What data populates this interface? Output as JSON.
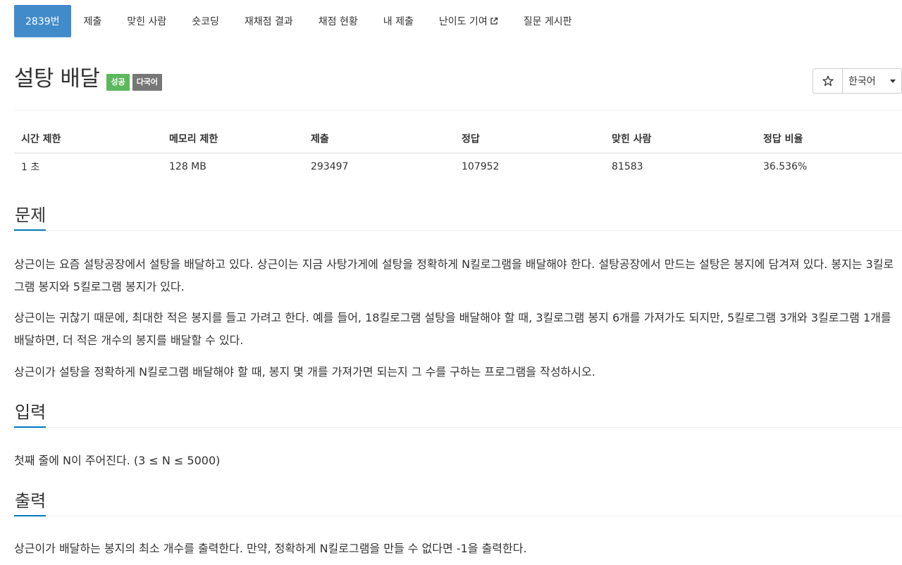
{
  "tabs": [
    {
      "label": "2839번",
      "active": true
    },
    {
      "label": "제출",
      "active": false
    },
    {
      "label": "맞힌 사람",
      "active": false
    },
    {
      "label": "숏코딩",
      "active": false
    },
    {
      "label": "재채점 결과",
      "active": false
    },
    {
      "label": "채점 현황",
      "active": false
    },
    {
      "label": "내 제출",
      "active": false
    },
    {
      "label": "난이도 기여",
      "active": false,
      "icon": "external-link-icon"
    },
    {
      "label": "질문 게시판",
      "active": false
    }
  ],
  "problem": {
    "title": "설탕 배달",
    "badges": [
      {
        "label": "성공",
        "color": "#5cb85c"
      },
      {
        "label": "다국어",
        "color": "#777777"
      }
    ]
  },
  "controls": {
    "favorite_icon": "star-icon",
    "language_label": "한국어"
  },
  "info_table": {
    "headers": [
      "시간 제한",
      "메모리 제한",
      "제출",
      "정답",
      "맞힌 사람",
      "정답 비율"
    ],
    "values": [
      "1 초",
      "128 MB",
      "293497",
      "107952",
      "81583",
      "36.536%"
    ]
  },
  "sections": {
    "description": {
      "heading": "문제",
      "paragraphs": [
        "상근이는 요즘 설탕공장에서 설탕을 배달하고 있다. 상근이는 지금 사탕가게에 설탕을 정확하게 N킬로그램을 배달해야 한다. 설탕공장에서 만드는 설탕은 봉지에 담겨져 있다. 봉지는 3킬로그램 봉지와 5킬로그램 봉지가 있다.",
        "상근이는 귀찮기 때문에, 최대한 적은 봉지를 들고 가려고 한다. 예를 들어, 18킬로그램 설탕을 배달해야 할 때, 3킬로그램 봉지 6개를 가져가도 되지만, 5킬로그램 3개와 3킬로그램 1개를 배달하면, 더 적은 개수의 봉지를 배달할 수 있다.",
        "상근이가 설탕을 정확하게 N킬로그램 배달해야 할 때, 봉지 몇 개를 가져가면 되는지 그 수를 구하는 프로그램을 작성하시오."
      ]
    },
    "input": {
      "heading": "입력",
      "text": "첫째 줄에 N이 주어진다. (3 ≤ N ≤ 5000)"
    },
    "output": {
      "heading": "출력",
      "text": "상근이가 배달하는 봉지의 최소 개수를 출력한다. 만약, 정확하게 N킬로그램을 만들 수 없다면 -1을 출력한다."
    }
  }
}
